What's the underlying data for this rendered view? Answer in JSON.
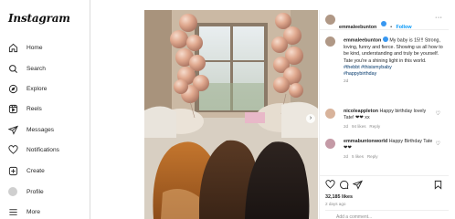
{
  "app": {
    "logo_text": "Instagram"
  },
  "sidebar": {
    "items": [
      {
        "label": "Home",
        "icon": "home-icon"
      },
      {
        "label": "Search",
        "icon": "search-icon"
      },
      {
        "label": "Explore",
        "icon": "compass-icon"
      },
      {
        "label": "Reels",
        "icon": "reels-icon"
      },
      {
        "label": "Messages",
        "icon": "messenger-icon"
      },
      {
        "label": "Notifications",
        "icon": "heart-icon"
      },
      {
        "label": "Create",
        "icon": "plus-square-icon"
      },
      {
        "label": "Profile",
        "icon": "avatar"
      },
      {
        "label": "More",
        "icon": "menu-icon"
      }
    ]
  },
  "post": {
    "author": "emmaleebunton",
    "follow_label": "Follow",
    "separator": "•",
    "caption_user": "emmaleebunton",
    "caption_text": "My baby is 15!!! Strong, loving, funny and fierce. Showing us all how to be kind, understanding and truly be yourself. Tate you're a shining light in this world.",
    "hashtags": [
      "#thebbt",
      "#thisismybaby",
      "#happybirthday"
    ],
    "caption_age": "2d",
    "comments": [
      {
        "user": "nicoleappleton",
        "text": "Happy birthday lovely Tate! ❤❤ xx",
        "age": "2d",
        "likes": "94 likes",
        "reply": "Reply"
      },
      {
        "user": "emmabuntonworld",
        "text": "Happy Birthday Tate ❤❤",
        "age": "2d",
        "likes": "5 likes",
        "reply": "Reply"
      }
    ],
    "likes_count": "32,185 likes",
    "time_ago": "2 days ago",
    "add_comment_placeholder": "Add a comment..."
  },
  "colors": {
    "accent": "#0095f6",
    "verified": "#3897f0",
    "hashtag": "#00376b",
    "muted": "#8e8e8e"
  }
}
